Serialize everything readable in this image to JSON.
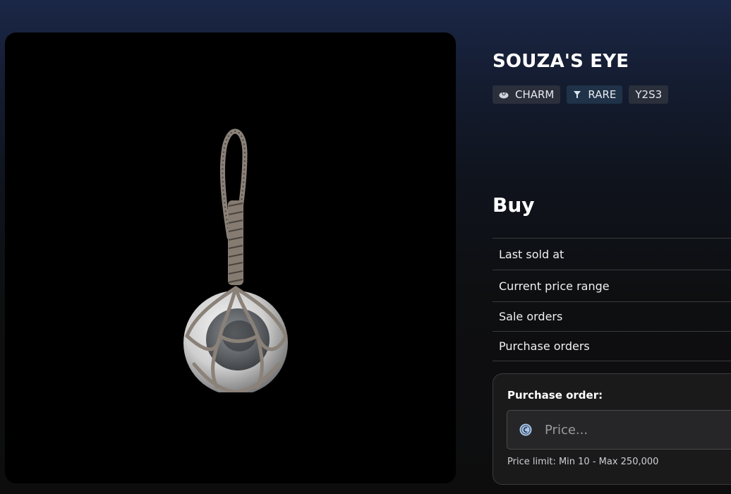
{
  "item": {
    "name": "SOUZA'S EYE",
    "image_alt": "Souza's Eye charm",
    "tags": [
      {
        "label": "CHARM",
        "icon": "charm-icon"
      },
      {
        "label": "RARE",
        "icon": "rarity-icon"
      },
      {
        "label": "Y2S3"
      }
    ]
  },
  "buy": {
    "heading": "Buy",
    "rows": [
      {
        "label": "Last sold at"
      },
      {
        "label": "Current price range"
      },
      {
        "label": "Sale orders"
      },
      {
        "label": "Purchase orders"
      }
    ]
  },
  "purchase_order": {
    "label": "Purchase order:",
    "price_placeholder": "Price...",
    "currency_icon": "credits-coin-icon",
    "price_limit": "Price limit: Min 10 - Max 250,000"
  },
  "colors": {
    "background_top": "#1b2747",
    "background_bottom": "#0d0d0e",
    "rare_tag": "#1f3247",
    "tag": "#2a2f3b"
  }
}
